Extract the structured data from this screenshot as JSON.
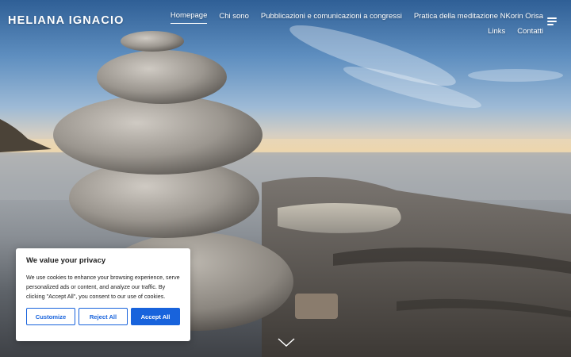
{
  "site": {
    "title": "HELIANA IGNACIO"
  },
  "nav": {
    "items": [
      {
        "label": "Homepage",
        "active": true
      },
      {
        "label": "Chi sono"
      },
      {
        "label": "Pubblicazioni e comunicazioni a congressi"
      },
      {
        "label": "Pratica della meditazione NKorin Orisa"
      },
      {
        "label": "Links"
      },
      {
        "label": "Contatti"
      }
    ],
    "menu_icon": "hamburger-menu-icon"
  },
  "hero": {
    "scroll_icon": "chevron-down-icon"
  },
  "cookie": {
    "title": "We value your privacy",
    "text": "We use cookies to enhance your browsing experience, serve personalized ads or content, and analyze our traffic. By clicking \"Accept All\", you consent to our use of cookies.",
    "buttons": {
      "customize": "Customize",
      "reject": "Reject All",
      "accept": "Accept All"
    },
    "accent_color": "#1863dc"
  }
}
